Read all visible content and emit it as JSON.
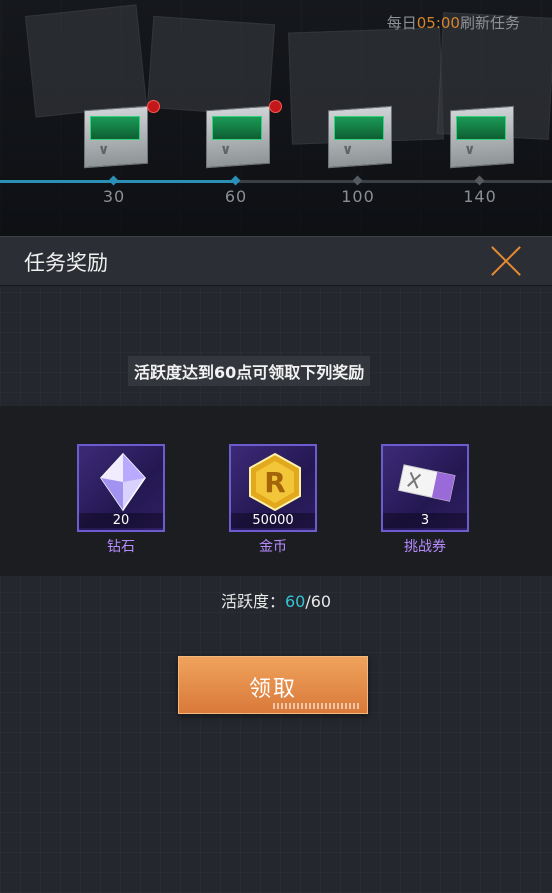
{
  "header": {
    "refresh_prefix": "每日",
    "refresh_time": "05:00",
    "refresh_suffix": "刷新任务"
  },
  "milestones": [
    {
      "value": "30",
      "reached": true
    },
    {
      "value": "60",
      "reached": true
    },
    {
      "value": "100",
      "reached": false
    },
    {
      "value": "140",
      "reached": false
    }
  ],
  "progress_fraction": 0.43,
  "modal": {
    "title": "任务奖励",
    "description": "活跃度达到60点可领取下列奖励",
    "rewards": [
      {
        "name": "钻石",
        "quantity": "20",
        "icon": "diamond-icon"
      },
      {
        "name": "金币",
        "quantity": "50000",
        "icon": "gold-coin-icon"
      },
      {
        "name": "挑战券",
        "quantity": "3",
        "icon": "challenge-ticket-icon"
      }
    ],
    "activity_label": "活跃度：",
    "activity_current": "60",
    "activity_total": "/60",
    "claim_label": "领取"
  },
  "colors": {
    "accent_orange": "#e58a31",
    "activity_cyan": "#35c3d5",
    "reward_purple": "#b58bff",
    "progress_blue": "#2c8fb5"
  }
}
